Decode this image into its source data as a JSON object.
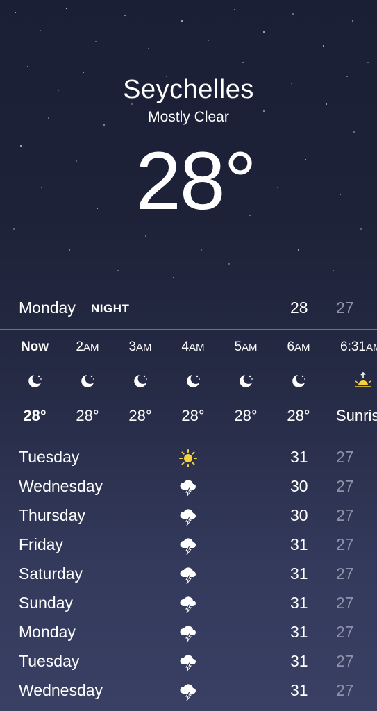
{
  "location": {
    "city": "Seychelles",
    "condition": "Mostly Clear",
    "temperature": "28°"
  },
  "today": {
    "day": "Monday",
    "period": "NIGHT",
    "high": "28",
    "low": "27"
  },
  "hourly": [
    {
      "time": "Now",
      "ampm": "",
      "icon": "moon-stars-icon",
      "temp": "28°"
    },
    {
      "time": "2",
      "ampm": "AM",
      "icon": "moon-stars-icon",
      "temp": "28°"
    },
    {
      "time": "3",
      "ampm": "AM",
      "icon": "moon-stars-icon",
      "temp": "28°"
    },
    {
      "time": "4",
      "ampm": "AM",
      "icon": "moon-stars-icon",
      "temp": "28°"
    },
    {
      "time": "5",
      "ampm": "AM",
      "icon": "moon-stars-icon",
      "temp": "28°"
    },
    {
      "time": "6",
      "ampm": "AM",
      "icon": "moon-stars-icon",
      "temp": "28°"
    },
    {
      "time": "6:31",
      "ampm": "AM",
      "icon": "sunrise-icon",
      "temp": "Sunrise"
    }
  ],
  "daily": [
    {
      "day": "Tuesday",
      "icon": "sun-icon",
      "high": "31",
      "low": "27"
    },
    {
      "day": "Wednesday",
      "icon": "thunderstorm-icon",
      "high": "30",
      "low": "27"
    },
    {
      "day": "Thursday",
      "icon": "thunderstorm-icon",
      "high": "30",
      "low": "27"
    },
    {
      "day": "Friday",
      "icon": "thunderstorm-icon",
      "high": "31",
      "low": "27"
    },
    {
      "day": "Saturday",
      "icon": "thunderstorm-icon",
      "high": "31",
      "low": "27"
    },
    {
      "day": "Sunday",
      "icon": "thunderstorm-icon",
      "high": "31",
      "low": "27"
    },
    {
      "day": "Monday",
      "icon": "thunderstorm-icon",
      "high": "31",
      "low": "27"
    },
    {
      "day": "Tuesday",
      "icon": "thunderstorm-icon",
      "high": "31",
      "low": "27"
    },
    {
      "day": "Wednesday",
      "icon": "thunderstorm-icon",
      "high": "31",
      "low": "27"
    }
  ],
  "colors": {
    "text": "#ffffff",
    "low_temp": "#8e93a8",
    "sun": "#f6d23c"
  }
}
